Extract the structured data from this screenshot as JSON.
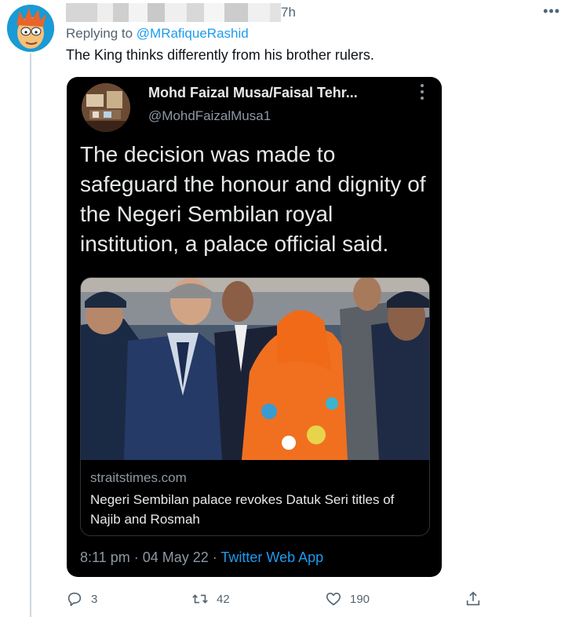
{
  "tweet": {
    "time": "7h",
    "more": "•••",
    "replying_prefix": "Replying to ",
    "replying_handle": "@MRafiqueRashid",
    "text": "The King thinks differently from his brother rulers."
  },
  "quoted": {
    "name": "Mohd Faizal Musa/Faisal Tehr...",
    "handle": "@MohdFaizalMusa1",
    "text": "The decision was made to safeguard the honour and dignity of the Negeri Sembilan royal institution, a palace official said.",
    "link_domain": "straitstimes.com",
    "link_title": "Negeri Sembilan palace revokes Datuk Seri titles of Najib and Rosmah",
    "meta_time": "8:11 pm · 04 May 22 · ",
    "meta_source": "Twitter Web App"
  },
  "actions": {
    "replies": "3",
    "retweets": "42",
    "likes": "190"
  },
  "colors": {
    "link": "#1d9bf0",
    "muted": "#536471",
    "card_bg": "#000000"
  },
  "icons": [
    "reply-icon",
    "retweet-icon",
    "like-icon",
    "share-icon",
    "more-icon"
  ]
}
